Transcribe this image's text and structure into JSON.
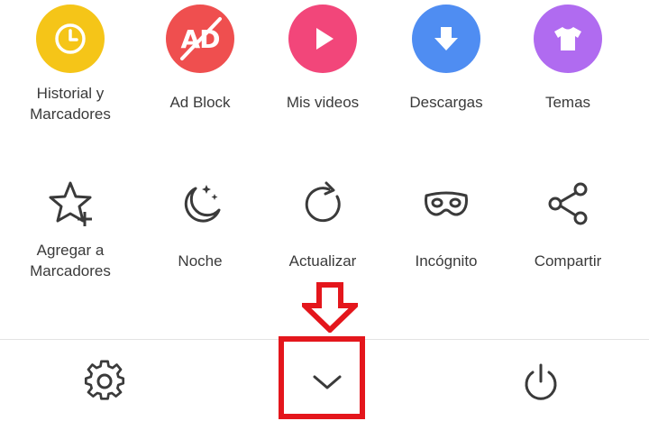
{
  "colors": {
    "historial": "#F5C518",
    "adblock": "#EF4F4F",
    "videos": "#F2467A",
    "descargas": "#4F8DF2",
    "temas": "#B06BF0",
    "highlight": "#E4161C",
    "icon_stroke": "#3A3A3A"
  },
  "menu": {
    "historial": {
      "label": "Historial y\nMarcadores",
      "icon": "clock-icon"
    },
    "adblock": {
      "label": "Ad Block",
      "icon": "ad-block-icon",
      "badge": "AD"
    },
    "videos": {
      "label": "Mis videos",
      "icon": "play-icon"
    },
    "descargas": {
      "label": "Descargas",
      "icon": "download-icon"
    },
    "temas": {
      "label": "Temas",
      "icon": "tshirt-icon"
    },
    "agregar": {
      "label": "Agregar a\nMarcadores",
      "icon": "star-plus-icon"
    },
    "noche": {
      "label": "Noche",
      "icon": "moon-icon"
    },
    "actualizar": {
      "label": "Actualizar",
      "icon": "refresh-icon"
    },
    "incognito": {
      "label": "Incógnito",
      "icon": "mask-icon"
    },
    "compartir": {
      "label": "Compartir",
      "icon": "share-icon"
    }
  },
  "bottom_bar": {
    "settings_icon": "gear-icon",
    "collapse_icon": "chevron-down-icon",
    "power_icon": "power-icon"
  }
}
